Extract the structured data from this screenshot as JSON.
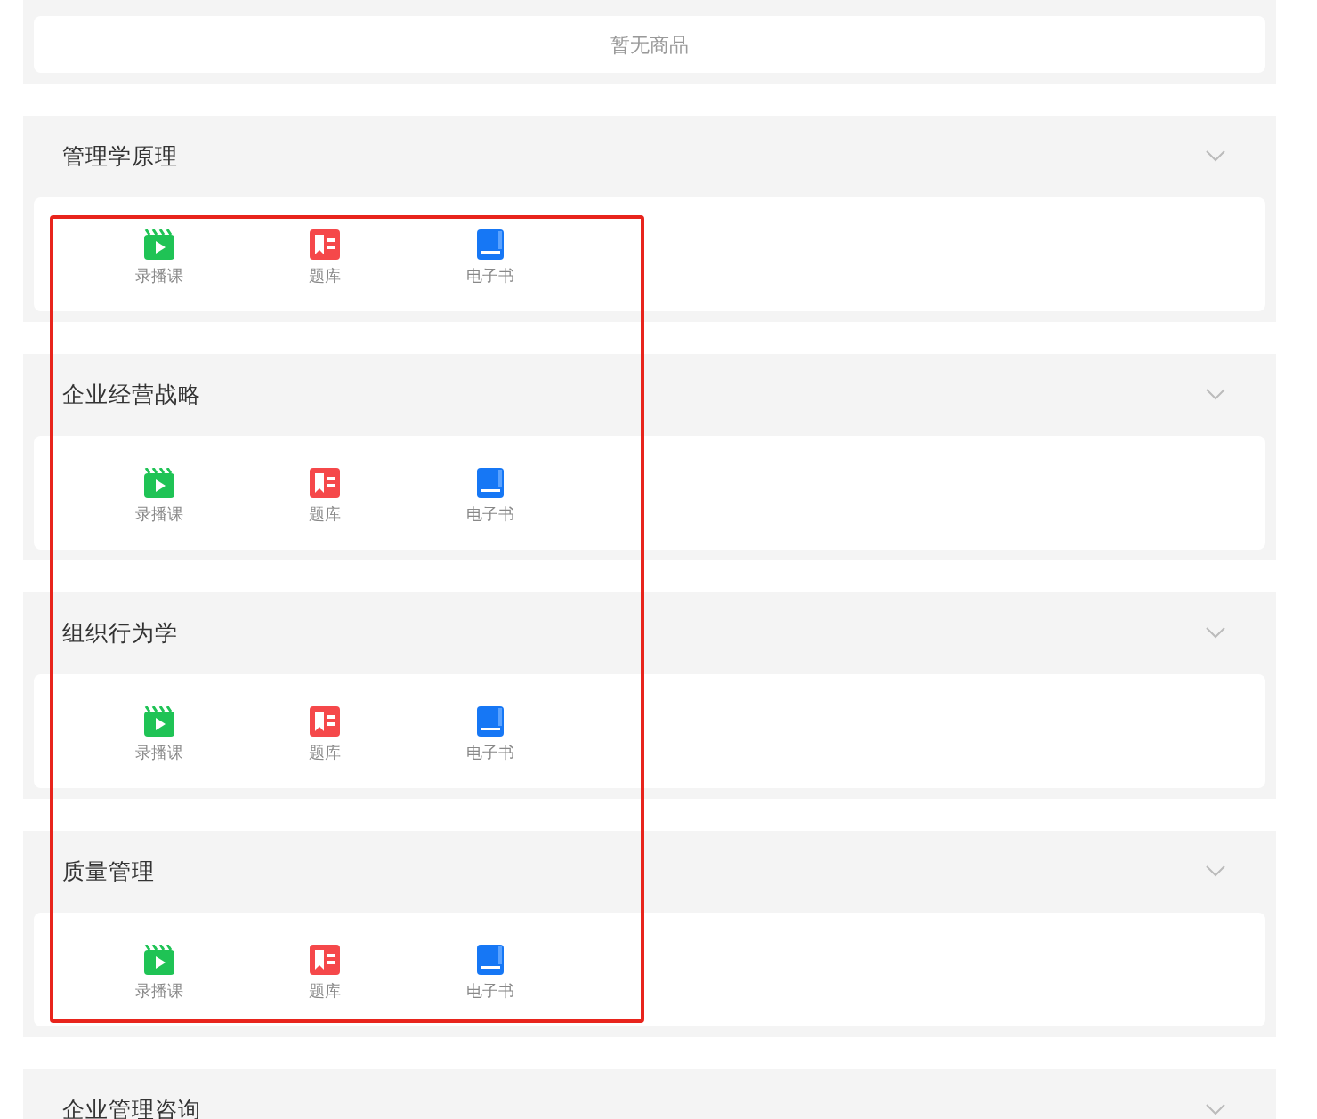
{
  "empty_notice": "暂无商品",
  "courses": [
    {
      "title": "管理学原理",
      "resources": [
        {
          "kind": "video",
          "label": "录播课"
        },
        {
          "kind": "question_bank",
          "label": "题库"
        },
        {
          "kind": "ebook",
          "label": "电子书"
        }
      ]
    },
    {
      "title": "企业经营战略",
      "resources": [
        {
          "kind": "video",
          "label": "录播课"
        },
        {
          "kind": "question_bank",
          "label": "题库"
        },
        {
          "kind": "ebook",
          "label": "电子书"
        }
      ]
    },
    {
      "title": "组织行为学",
      "resources": [
        {
          "kind": "video",
          "label": "录播课"
        },
        {
          "kind": "question_bank",
          "label": "题库"
        },
        {
          "kind": "ebook",
          "label": "电子书"
        }
      ]
    },
    {
      "title": "质量管理",
      "resources": [
        {
          "kind": "video",
          "label": "录播课"
        },
        {
          "kind": "question_bank",
          "label": "题库"
        },
        {
          "kind": "ebook",
          "label": "电子书"
        }
      ]
    },
    {
      "title": "企业管理咨询"
    }
  ]
}
